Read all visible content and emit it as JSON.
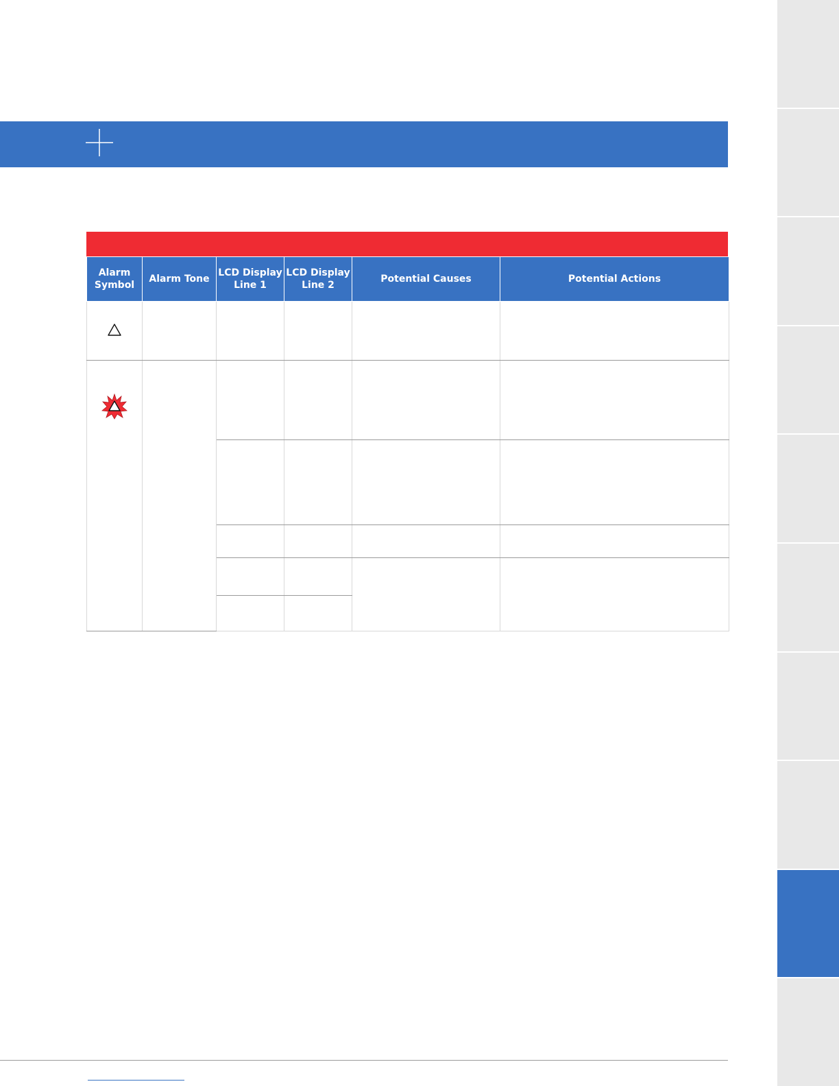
{
  "colors": {
    "brand_blue": "#3872c2",
    "alarm_red": "#ef2b33",
    "tab_gray": "#e8e8e8"
  },
  "banner": {
    "icon": "cross-icon"
  },
  "table": {
    "headers": [
      "Alarm Symbol",
      "Alarm Tone",
      "LCD Display Line 1",
      "LCD Display Line 2",
      "Potential Causes",
      "Potential Actions"
    ],
    "symbols": {
      "row1": "warning-triangle-icon",
      "row2": "alarm-burst-icon"
    }
  },
  "side_tabs": {
    "count": 10,
    "active_index": 8
  }
}
